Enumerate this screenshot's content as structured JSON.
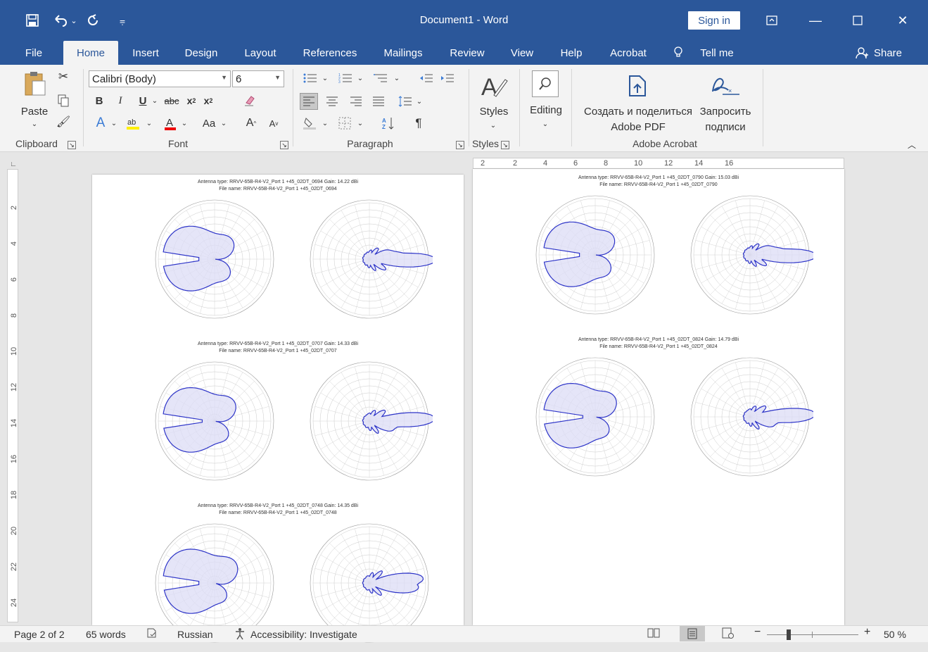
{
  "titlebar": {
    "title": "Document1  -  Word",
    "signin_label": "Sign in"
  },
  "tabs": [
    "File",
    "Home",
    "Insert",
    "Design",
    "Layout",
    "References",
    "Mailings",
    "Review",
    "View",
    "Help",
    "Acrobat",
    "Tell me",
    "Share"
  ],
  "ribbon": {
    "clipboard": {
      "paste_label": "Paste",
      "group_label": "Clipboard"
    },
    "font": {
      "font_name": "Calibri (Body)",
      "font_size": "6",
      "group_label": "Font"
    },
    "paragraph": {
      "group_label": "Paragraph"
    },
    "styles": {
      "label": "Styles",
      "group_label": "Styles"
    },
    "editing": {
      "label": "Editing"
    },
    "acrobat": {
      "create_label_1": "Создать и поделиться",
      "create_label_2": "Adobe PDF",
      "request_label_1": "Запросить",
      "request_label_2": "подписи",
      "group_label": "Adobe Acrobat"
    }
  },
  "ruler": {
    "top_ticks": [
      "2",
      "2",
      "4",
      "6",
      "8",
      "10",
      "12",
      "14",
      "16"
    ],
    "left_ticks": [
      "2",
      "4",
      "6",
      "8",
      "10",
      "12",
      "14",
      "16",
      "18",
      "20",
      "22",
      "24"
    ]
  },
  "pages": {
    "left": [
      {
        "line1": "Antenna type: RRVV-65B-R4-V2_Port 1 +45_02DT_0694   Gain: 14.22 dBi",
        "line2": "File name: RRVV-65B-R4-V2_Port 1 +45_02DT_0694"
      },
      {
        "line1": "Antenna type: RRVV-65B-R4-V2_Port 1 +45_02DT_0707   Gain: 14.33 dBi",
        "line2": "File name: RRVV-65B-R4-V2_Port 1 +45_02DT_0707"
      },
      {
        "line1": "Antenna type: RRVV-65B-R4-V2_Port 1 +45_02DT_0748   Gain: 14.35 dBi",
        "line2": "File name: RRVV-65B-R4-V2_Port 1 +45_02DT_0748"
      }
    ],
    "right": [
      {
        "line1": "Antenna type: RRVV-65B-R4-V2_Port 1 +45_02DT_0790   Gain: 15.03 dBi",
        "line2": "File name: RRVV-65B-R4-V2_Port 1 +45_02DT_0790"
      },
      {
        "line1": "Antenna type: RRVV-65B-R4-V2_Port 1 +45_02DT_0824   Gain: 14.79 dBi",
        "line2": "File name: RRVV-65B-R4-V2_Port 1 +45_02DT_0824"
      }
    ]
  },
  "statusbar": {
    "page": "Page 2 of 2",
    "words": "65 words",
    "language": "Russian",
    "accessibility": "Accessibility: Investigate",
    "zoom": "50 %"
  },
  "colors": {
    "brand": "#2b579a",
    "pattern_line": "#2d34c8",
    "pattern_fill": "#dcdcf5"
  }
}
